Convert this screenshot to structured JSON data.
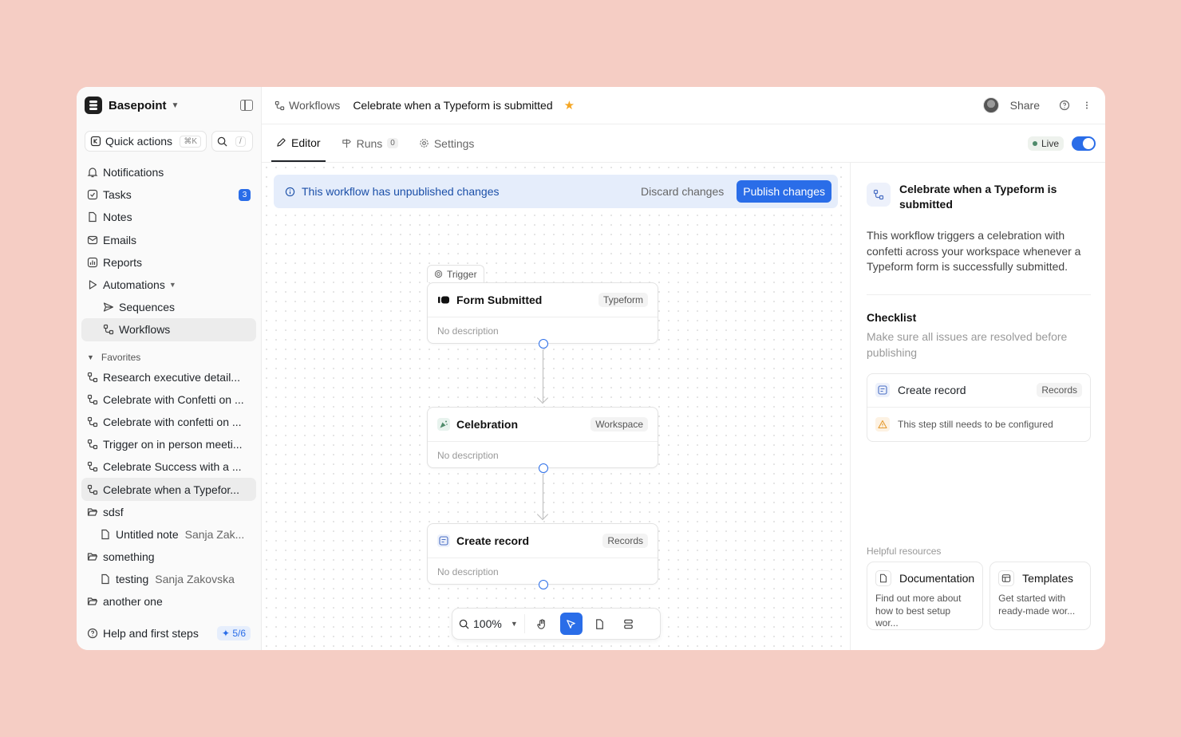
{
  "sidebar": {
    "brand": "Basepoint",
    "quick_actions": "Quick actions",
    "quick_actions_shortcut": "⌘K",
    "search_shortcut": "/",
    "nav": [
      {
        "label": "Notifications"
      },
      {
        "label": "Tasks",
        "badge": "3"
      },
      {
        "label": "Notes"
      },
      {
        "label": "Emails"
      },
      {
        "label": "Reports"
      },
      {
        "label": "Automations"
      }
    ],
    "automations_children": [
      {
        "label": "Sequences"
      },
      {
        "label": "Workflows"
      }
    ],
    "favorites_label": "Favorites",
    "favorites": [
      {
        "label": "Research executive detail..."
      },
      {
        "label": "Celebrate with Confetti on ..."
      },
      {
        "label": "Celebrate with confetti on ..."
      },
      {
        "label": "Trigger on in person meeti..."
      },
      {
        "label": "Celebrate Success with a ..."
      },
      {
        "label": "Celebrate when a Typefor..."
      }
    ],
    "folders": [
      {
        "label": "sdsf",
        "note": "Untitled note",
        "owner": "Sanja Zak..."
      },
      {
        "label": "something",
        "note": "testing",
        "owner": "Sanja Zakovska"
      },
      {
        "label": "another one"
      }
    ],
    "help_label": "Help and first steps",
    "help_progress": "5/6"
  },
  "header": {
    "breadcrumb_root": "Workflows",
    "title": "Celebrate when a Typeform is submitted",
    "share": "Share"
  },
  "tabs": [
    {
      "label": "Editor"
    },
    {
      "label": "Runs",
      "count": "0"
    },
    {
      "label": "Settings"
    }
  ],
  "status": {
    "live": "Live",
    "enabled": true
  },
  "banner": {
    "message": "This workflow has unpublished changes",
    "discard": "Discard changes",
    "publish": "Publish changes"
  },
  "canvas": {
    "trigger_label": "Trigger",
    "nodes": [
      {
        "title": "Form Submitted",
        "tag": "Typeform",
        "desc": "No description"
      },
      {
        "title": "Celebration",
        "tag": "Workspace",
        "desc": "No description"
      },
      {
        "title": "Create record",
        "tag": "Records",
        "desc": "No description"
      }
    ],
    "zoom": "100%"
  },
  "panel": {
    "title": "Celebrate when a Typeform is submitted",
    "description": "This workflow triggers a celebration with confetti across your workspace whenever a Typeform form is successfully submitted.",
    "checklist_title": "Checklist",
    "checklist_sub": "Make sure all issues are resolved before publishing",
    "check_item": {
      "title": "Create record",
      "tag": "Records",
      "warning": "This step still needs to be configured"
    },
    "resources_label": "Helpful resources",
    "resources": [
      {
        "title": "Documentation",
        "desc": "Find out more about how to best setup wor..."
      },
      {
        "title": "Templates",
        "desc": "Get started with ready-made wor..."
      }
    ]
  },
  "colors": {
    "accent": "#2a6de8",
    "background": "#f5cdc4",
    "star": "#f5a623"
  }
}
